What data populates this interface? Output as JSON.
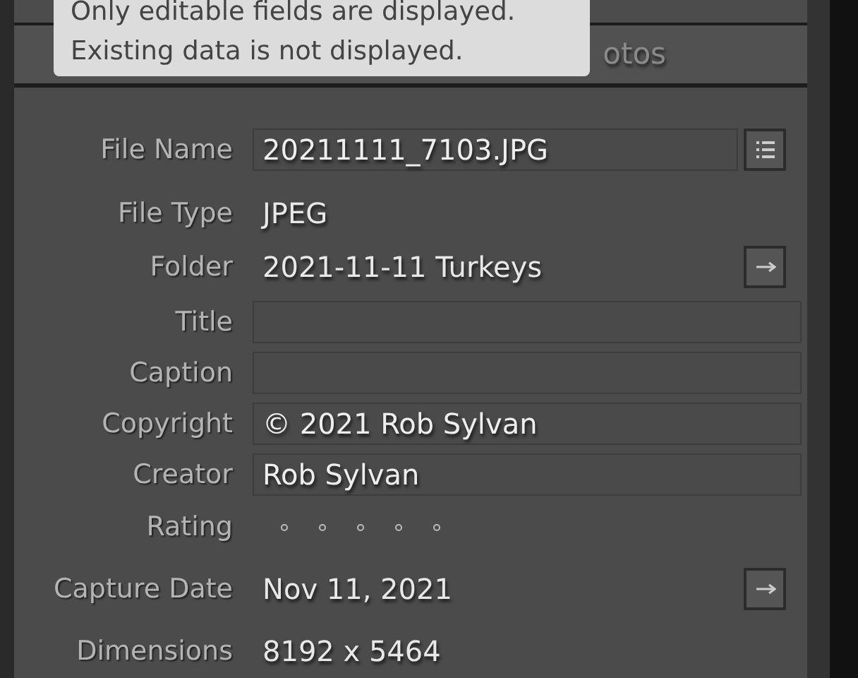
{
  "tooltip": {
    "lines": [
      "Only editable fields are displayed.",
      "Existing data is not displayed."
    ]
  },
  "tab_bar": {
    "visible_text": "otos"
  },
  "fields": [
    {
      "label": "File Name",
      "kind": "field",
      "value": "20211111_7103.JPG",
      "list_button": true
    },
    {
      "label": "File Type",
      "kind": "text",
      "value": "JPEG"
    },
    {
      "label": "Folder",
      "kind": "text",
      "value": "2021-11-11 Turkeys",
      "arrow_button": true
    },
    {
      "label": "Title",
      "kind": "field"
    },
    {
      "label": "Caption",
      "kind": "field"
    },
    {
      "label": "Copyright",
      "kind": "field",
      "value": "© 2021 Rob Sylvan"
    },
    {
      "label": "Creator",
      "kind": "field",
      "value": "Rob Sylvan"
    },
    {
      "label": "Rating",
      "kind": "rating",
      "stars": 0
    },
    {
      "label": "Capture Date",
      "kind": "text",
      "value": "Nov 11, 2021",
      "arrow_button": true
    },
    {
      "label": "Dimensions",
      "kind": "text",
      "value": "8192 x 5464"
    }
  ]
}
